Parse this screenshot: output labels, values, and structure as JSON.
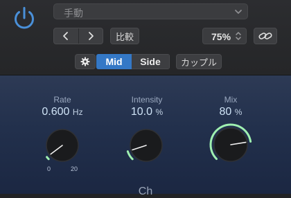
{
  "header": {
    "preset_value": "手動",
    "compare_label": "比較",
    "zoom_value": "75%",
    "couple_label": "カップル"
  },
  "mode_tabs": [
    {
      "label": "Mid",
      "selected": true
    },
    {
      "label": "Side",
      "selected": false
    }
  ],
  "params": {
    "rate": {
      "label": "Rate",
      "value": "0.600",
      "unit": "Hz",
      "scale_min": "0",
      "scale_max": "20",
      "level": 0.03
    },
    "intensity": {
      "label": "Intensity",
      "value": "10.0",
      "unit": "%",
      "level": 0.1
    },
    "mix": {
      "label": "Mix",
      "value": "80",
      "unit": "%",
      "level": 0.8
    }
  },
  "footer": {
    "text": "Ch"
  },
  "colors": {
    "accent_blue": "#3478c6",
    "power_icon": "#4a90d9",
    "knob_arc": "#9ff0b0",
    "panel_top": "#2d3a55",
    "panel_bottom": "#1b2742"
  }
}
